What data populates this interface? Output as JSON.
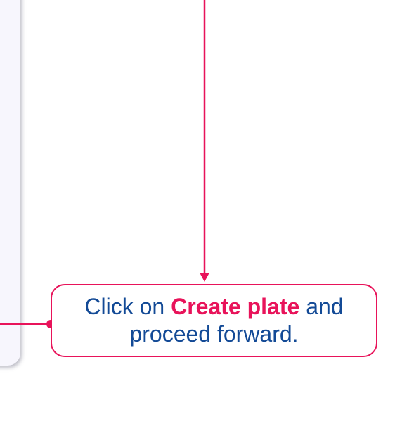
{
  "callout": {
    "prefix": "Click on ",
    "highlight": "Create plate",
    "suffix": " and proceed forward."
  },
  "colors": {
    "accent": "#e8135a",
    "text": "#134a96",
    "panel": "#f7f6fd"
  }
}
